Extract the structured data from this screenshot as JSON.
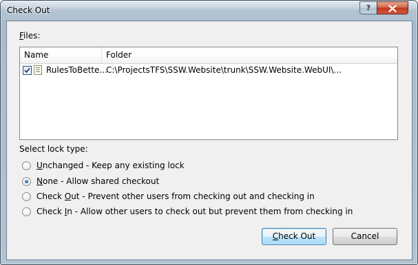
{
  "window": {
    "title": "Check Out",
    "help_glyph": "?",
    "close_icon": "close-icon"
  },
  "files_section": {
    "label_accel": "F",
    "label_rest": "iles:",
    "columns": [
      "Name",
      "Folder"
    ],
    "rows": [
      {
        "checked": true,
        "name": "RulesToBette...",
        "folder": "C:\\ProjectsTFS\\SSW.Website\\trunk\\SSW.Website.WebUI\\..."
      }
    ]
  },
  "lock_section": {
    "label": "Select lock type:",
    "selected": "None",
    "options": [
      {
        "accel": "U",
        "rest": "nchanged - Keep any existing lock",
        "checked": false
      },
      {
        "accel": "N",
        "rest": "one - Allow shared checkout",
        "checked": true
      },
      {
        "pre": "Check ",
        "accel": "O",
        "rest": "ut - Prevent other users from checking out and checking in",
        "checked": false
      },
      {
        "pre": "Check ",
        "accel": "I",
        "rest": "n - Allow other users to check out but prevent them from checking in",
        "checked": false
      }
    ]
  },
  "buttons": {
    "checkout_accel": "C",
    "checkout_rest": "heck Out",
    "cancel": "Cancel"
  },
  "colors": {
    "frame": "#b4c4d3",
    "close_button": "#c0391f",
    "default_button_border": "#3c7fb1",
    "radio_selected": "#1a5ea8"
  }
}
